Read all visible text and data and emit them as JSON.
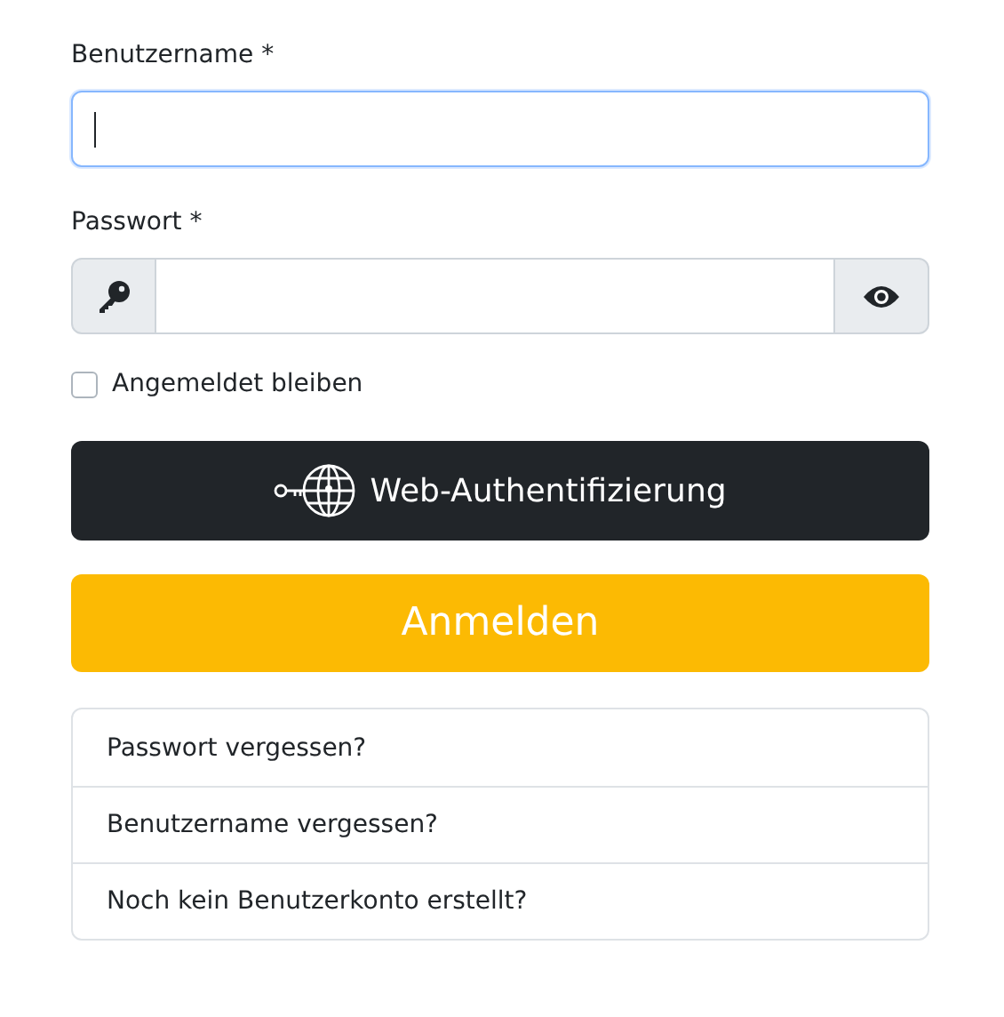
{
  "username": {
    "label": "Benutzername *",
    "focused": true
  },
  "password": {
    "label": "Passwort *"
  },
  "remember": {
    "label": "Angemeldet bleiben",
    "checked": false
  },
  "webauthn_button": {
    "label": "Web-Authentifizierung"
  },
  "login_button": {
    "label": "Anmelden"
  },
  "links": [
    {
      "label": "Passwort vergessen?"
    },
    {
      "label": "Benutzername vergessen?"
    },
    {
      "label": "Noch kein Benutzerkonto erstellt?"
    }
  ]
}
